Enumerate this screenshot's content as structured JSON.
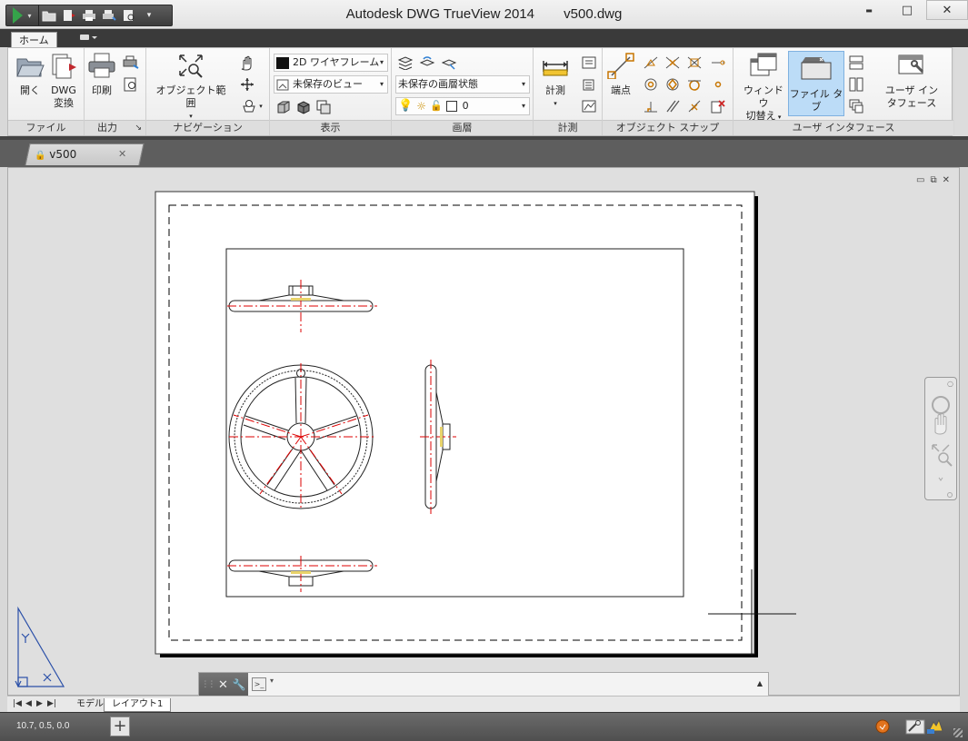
{
  "window": {
    "app_title": "Autodesk DWG TrueView 2014",
    "file_title": "v500.dwg",
    "minimize": "▬",
    "maximize": "□",
    "close": "✕"
  },
  "ribbon": {
    "tabs": [
      "ホーム",
      ""
    ],
    "file_panel": {
      "title": "ファイル",
      "open": "開く",
      "dwg_convert": [
        "DWG",
        "変換"
      ]
    },
    "output_panel": {
      "title": "出力",
      "print": "印刷",
      "launcher": "↘"
    },
    "navigation_panel": {
      "title": "ナビゲーション",
      "extents": "オブジェクト範囲"
    },
    "view_panel": {
      "title": "表示",
      "visual_style": "2D ワイヤフレーム",
      "named_view": "未保存のビュー"
    },
    "layers_panel": {
      "title": "画層",
      "layer_state": "未保存の画層状態",
      "current_layer": "0"
    },
    "measure_panel": {
      "title": "計測",
      "measure": "計測"
    },
    "osnap_panel": {
      "title": "オブジェクト スナップ",
      "endpoint": "端点"
    },
    "ui_panel": {
      "title": "ユーザ インタフェース",
      "switch_windows": [
        "ウィンドウ",
        "切替え"
      ],
      "file_tabs": "ファイル タブ",
      "user_interface": [
        "ユーザ イン",
        "タフェース"
      ]
    }
  },
  "file_tabs": [
    {
      "label": "v500",
      "close": "✕"
    }
  ],
  "canvas_controls": {
    "minimize": "▭",
    "restore": "⧉",
    "close": "✕"
  },
  "command_line": {
    "close": "✕",
    "customize": "🔧",
    "prompt": ">_",
    "history": "▲"
  },
  "layout_tabs": {
    "nav": [
      "|◀",
      "◀",
      "▶",
      "▶|"
    ],
    "model": "モデル",
    "layout1": "レイアウト1"
  },
  "status": {
    "coordinates": "10.7, 0.5, 0.0"
  },
  "colors": {
    "accent": "#9cc8ee",
    "title_bar": "#e9e9e9",
    "ribbon_tabs": "#3a3a3a",
    "status_bar": "#5a5a5a"
  }
}
